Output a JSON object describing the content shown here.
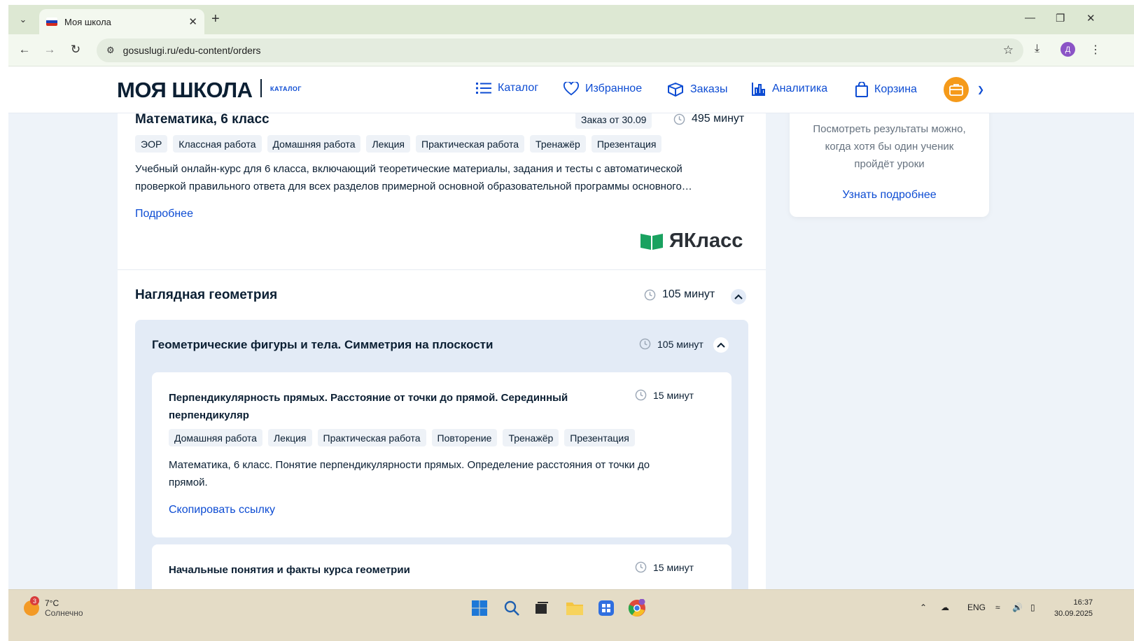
{
  "browser": {
    "tab_title": "Моя школа",
    "url": "gosuslugi.ru/edu-content/orders",
    "profile_initial": "Д"
  },
  "header": {
    "logo": "МОЯ ШКОЛА",
    "logo_sub": "КАТАЛОГ",
    "nav": {
      "catalog": "Каталог",
      "favorites": "Избранное",
      "orders": "Заказы",
      "analytics": "Аналитика",
      "cart": "Корзина"
    }
  },
  "course": {
    "title": "Математика, 6 класс",
    "order_badge": "Заказ от 30.09",
    "duration": "495 минут",
    "tags": [
      "ЭОР",
      "Классная работа",
      "Домашняя работа",
      "Лекция",
      "Практическая работа",
      "Тренажёр",
      "Презентация"
    ],
    "description_line1": "Учебный онлайн-курс для 6 класса, включающий теоретические материалы, задания и тесты с автоматической",
    "description_line2": "проверкой правильного ответа для всех разделов примерной основной образовательной программы основного…",
    "more_link": "Подробнее",
    "provider": "ЯКласс"
  },
  "section": {
    "title": "Наглядная геометрия",
    "duration": "105 минут",
    "subsection": {
      "title": "Геометрические фигуры и тела. Симметрия на плоскости",
      "duration": "105 минут",
      "lessons": [
        {
          "title_line1": "Перпендикулярность прямых. Расстояние от точки до прямой. Серединный",
          "title_line2": "перпендикуляр",
          "duration": "15 минут",
          "tags": [
            "Домашняя работа",
            "Лекция",
            "Практическая работа",
            "Повторение",
            "Тренажёр",
            "Презентация"
          ],
          "description_line1": "Математика, 6 класс. Понятие перпендикулярности прямых. Определение расстояния от точки до",
          "description_line2": "прямой.",
          "copy_link": "Скопировать ссылку"
        },
        {
          "title_line1": "Начальные понятия и факты курса геометрии",
          "duration": "15 минут"
        }
      ]
    }
  },
  "side_card": {
    "text_line1": "Посмотреть результаты можно,",
    "text_line2": "когда хотя бы один ученик",
    "text_line3": "пройдёт уроки",
    "link": "Узнать подробнее"
  },
  "taskbar": {
    "weather_badge": "3",
    "temperature": "7°C",
    "condition": "Солнечно",
    "language": "ENG",
    "time": "16:37",
    "date": "30.09.2025"
  },
  "colors": {
    "accent": "#0d4cd3",
    "text": "#0b1f33",
    "tag_bg": "#eef2f7",
    "panel_bg": "#e3ebf6",
    "avatar": "#f59a1a"
  }
}
